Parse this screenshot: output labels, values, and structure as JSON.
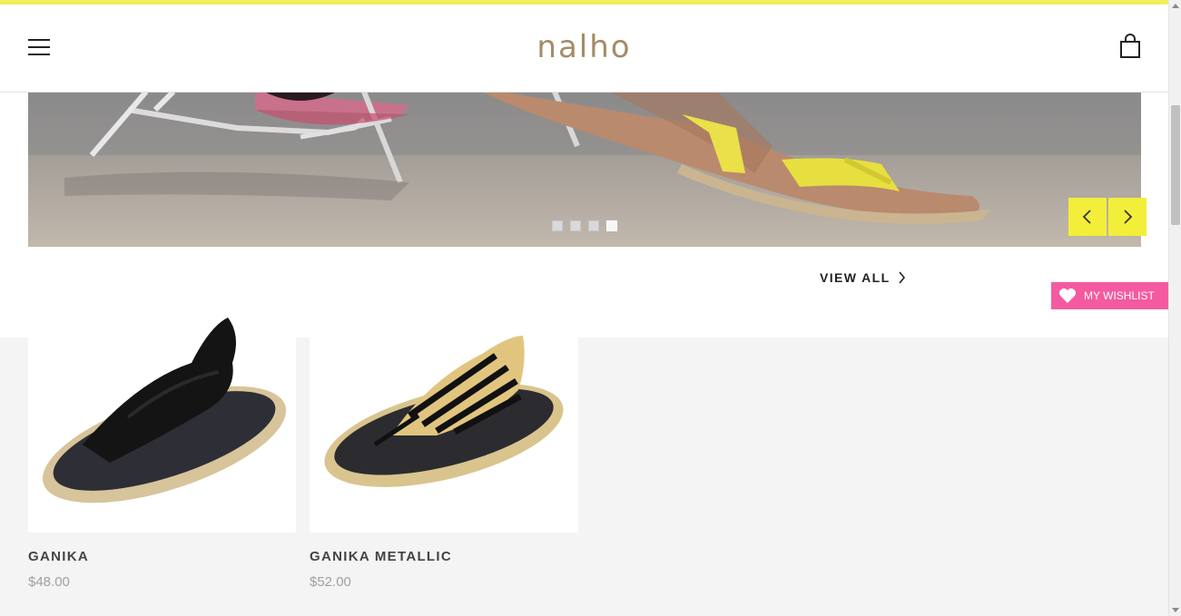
{
  "header": {
    "logo": "nalho",
    "menu_icon": "hamburger-menu-icon",
    "cart_icon": "shopping-bag-icon"
  },
  "hero": {
    "slide_count": 4,
    "active_slide": 4,
    "prev_icon": "chevron-left-icon",
    "next_icon": "chevron-right-icon"
  },
  "collection": {
    "view_all_label": "VIEW ALL"
  },
  "wishlist": {
    "label": "MY WISHLIST",
    "icon": "heart-icon"
  },
  "products": [
    {
      "name": "GANIKA",
      "price": "$48.00"
    },
    {
      "name": "GANIKA METALLIC",
      "price": "$52.00"
    }
  ],
  "colors": {
    "accent_yellow": "#f3ee3a",
    "wishlist_pink": "#f45aa0",
    "logo_tan": "#a48c68"
  }
}
